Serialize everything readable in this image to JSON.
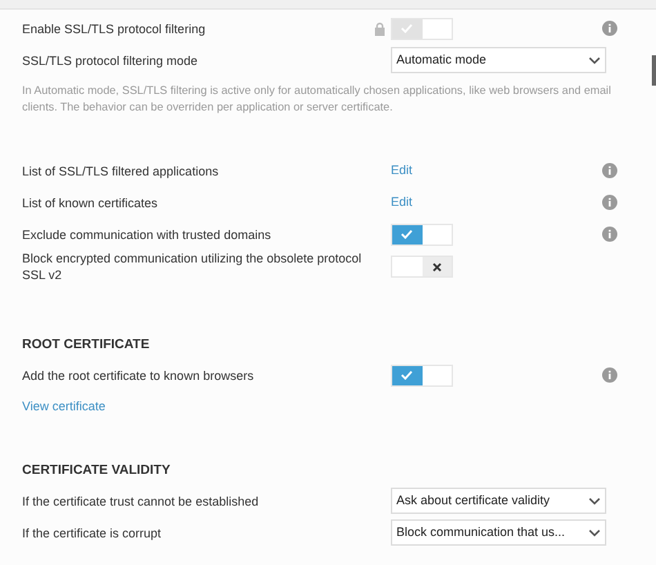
{
  "sections": [
    {
      "rows": [
        {
          "kind": "toggle",
          "label": "Enable SSL/TLS protocol filtering",
          "on": true,
          "locked": true,
          "info": true
        },
        {
          "kind": "select",
          "label": "SSL/TLS protocol filtering mode",
          "value": "Automatic mode"
        },
        {
          "kind": "note",
          "text": "In Automatic mode, SSL/TLS filtering is active only for automatically chosen applications, like web browsers and email clients. The behavior can be overriden per application or server certificate."
        }
      ]
    },
    {
      "rows": [
        {
          "kind": "link",
          "label": "List of SSL/TLS filtered applications",
          "link": "Edit",
          "info": true
        },
        {
          "kind": "link",
          "label": "List of known certificates",
          "link": "Edit",
          "info": true
        },
        {
          "kind": "toggle",
          "label": "Exclude communication with trusted domains",
          "on": true,
          "locked": false,
          "info": true
        },
        {
          "kind": "toggle",
          "label": "Block encrypted communication utilizing the obsolete protocol SSL v2",
          "on": false,
          "locked": false,
          "info": false
        }
      ]
    },
    {
      "title": "ROOT CERTIFICATE",
      "rows": [
        {
          "kind": "toggle",
          "label": "Add the root certificate to known browsers",
          "on": true,
          "locked": false,
          "info": true
        },
        {
          "kind": "action",
          "link": "View certificate"
        }
      ]
    },
    {
      "title": "CERTIFICATE VALIDITY",
      "rows": [
        {
          "kind": "select",
          "label": "If the certificate trust cannot be established",
          "value": "Ask about certificate validity"
        },
        {
          "kind": "select",
          "label": "If the certificate is corrupt",
          "value": "Block communication that us..."
        }
      ]
    }
  ]
}
